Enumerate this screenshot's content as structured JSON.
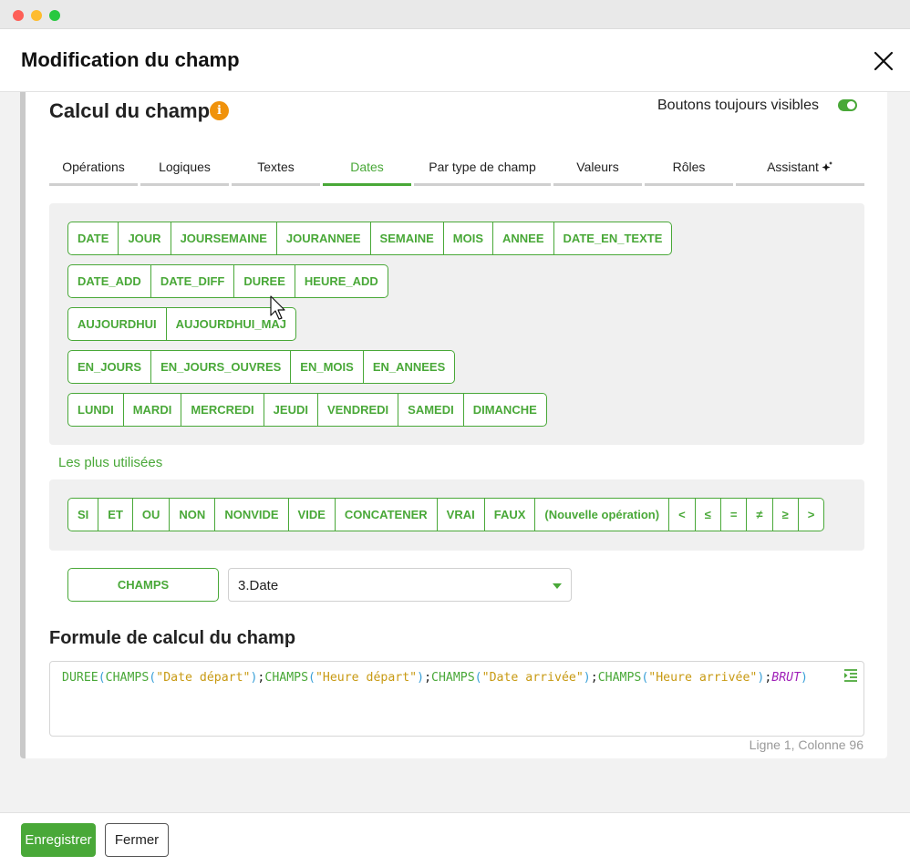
{
  "dialog": {
    "title": "Modification du champ"
  },
  "section": {
    "title": "Calcul du champ",
    "toggle_label": "Boutons toujours visibles",
    "toggle_on": true
  },
  "tabs": [
    {
      "label": "Opérations"
    },
    {
      "label": "Logiques"
    },
    {
      "label": "Textes"
    },
    {
      "label": "Dates"
    },
    {
      "label": "Par type de champ"
    },
    {
      "label": "Valeurs"
    },
    {
      "label": "Rôles"
    },
    {
      "label": "Assistant"
    }
  ],
  "active_tab": "Dates",
  "date_rows": [
    [
      "DATE",
      "JOUR",
      "JOURSEMAINE",
      "JOURANNEE",
      "SEMAINE",
      "MOIS",
      "ANNEE",
      "DATE_EN_TEXTE"
    ],
    [
      "DATE_ADD",
      "DATE_DIFF",
      "DUREE",
      "HEURE_ADD"
    ],
    [
      "AUJOURDHUI",
      "AUJOURDHUI_MAJ"
    ],
    [
      "EN_JOURS",
      "EN_JOURS_OUVRES",
      "EN_MOIS",
      "EN_ANNEES"
    ],
    [
      "LUNDI",
      "MARDI",
      "MERCREDI",
      "JEUDI",
      "VENDREDI",
      "SAMEDI",
      "DIMANCHE"
    ]
  ],
  "most_used": {
    "label": "Les plus utilisées",
    "buttons": [
      "SI",
      "ET",
      "OU",
      "NON",
      "NONVIDE",
      "VIDE",
      "CONCATENER",
      "VRAI",
      "FAUX",
      "(Nouvelle opération)",
      "<",
      "≤",
      "=",
      "≠",
      "≥",
      ">"
    ]
  },
  "field_picker": {
    "button_label": "CHAMPS",
    "selected": "3.Date"
  },
  "formula": {
    "title": "Formule de calcul du champ",
    "tokens": [
      {
        "t": "DUREE",
        "k": "fn"
      },
      {
        "t": "(",
        "k": "paren"
      },
      {
        "t": "CHAMPS",
        "k": "fn"
      },
      {
        "t": "(",
        "k": "paren"
      },
      {
        "t": "\"Date départ\"",
        "k": "str"
      },
      {
        "t": ")",
        "k": "paren"
      },
      {
        "t": ";",
        "k": "semi"
      },
      {
        "t": "CHAMPS",
        "k": "fn"
      },
      {
        "t": "(",
        "k": "paren"
      },
      {
        "t": "\"Heure départ\"",
        "k": "str"
      },
      {
        "t": ")",
        "k": "paren"
      },
      {
        "t": ";",
        "k": "semi"
      },
      {
        "t": "CHAMPS",
        "k": "fn"
      },
      {
        "t": "(",
        "k": "paren"
      },
      {
        "t": "\"Date arrivée\"",
        "k": "str"
      },
      {
        "t": ")",
        "k": "paren"
      },
      {
        "t": ";",
        "k": "semi"
      },
      {
        "t": "CHAMPS",
        "k": "fn"
      },
      {
        "t": "(",
        "k": "paren"
      },
      {
        "t": "\"Heure arrivée\"",
        "k": "str"
      },
      {
        "t": ")",
        "k": "paren"
      },
      {
        "t": ";",
        "k": "semi"
      },
      {
        "t": "BRUT",
        "k": "kw"
      },
      {
        "t": ")",
        "k": "paren"
      }
    ],
    "cursor_position": "Ligne 1, Colonne 96"
  },
  "footer": {
    "save_label": "Enregistrer",
    "close_label": "Fermer"
  },
  "colors": {
    "accent": "#49a838",
    "info": "#f0920b"
  }
}
